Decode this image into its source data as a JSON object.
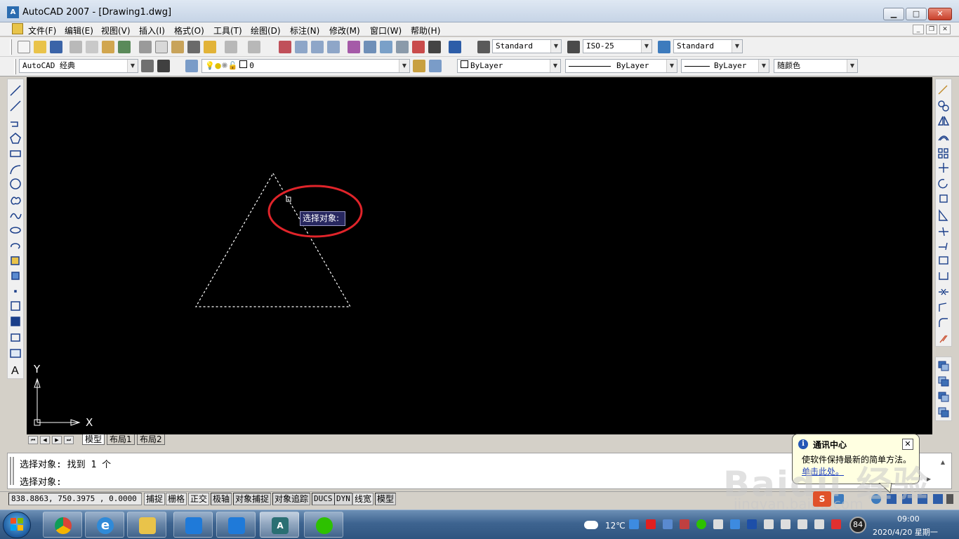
{
  "window": {
    "title": "AutoCAD 2007 - [Drawing1.dwg]",
    "min": "▁",
    "max": "□",
    "close": "✕"
  },
  "menu": [
    "文件(F)",
    "编辑(E)",
    "视图(V)",
    "插入(I)",
    "格式(O)",
    "工具(T)",
    "绘图(D)",
    "标注(N)",
    "修改(M)",
    "窗口(W)",
    "帮助(H)"
  ],
  "toolbar": {
    "text_style": "Standard",
    "dim_style": "ISO-25",
    "table_style": "Standard",
    "workspace": "AutoCAD 经典",
    "layer": "0",
    "color": "ByLayer",
    "linetype": "ByLayer",
    "lineweight": "ByLayer",
    "plotstyle": "随颜色"
  },
  "canvas": {
    "tooltip": "选择对象:",
    "axis_y": "Y",
    "axis_x": "X"
  },
  "layout_tabs": [
    "模型",
    "布局1",
    "布局2"
  ],
  "command": {
    "line1": "选择对象: 找到 1 个",
    "line2": "选择对象:"
  },
  "status": {
    "coords": "838.8863,  750.3975 , 0.0000",
    "toggles": [
      "捕捉",
      "栅格",
      "正交",
      "极轴",
      "对象捕捉",
      "对象追踪",
      "DUCS",
      "DYN",
      "线宽",
      "模型"
    ]
  },
  "balloon": {
    "title": "通讯中心",
    "message": "使软件保持最新的简单方法。",
    "link": "单击此处。"
  },
  "taskbar": {
    "weather": "12℃",
    "time": "09:00",
    "date": "2020/4/20 星期一",
    "badge": "84"
  },
  "watermark": {
    "logo": "Baidu 经验",
    "url": "jingyan.baidu.com"
  },
  "colors": {
    "canvas": "#000000",
    "highlight": "#e0242a",
    "tooltip_bg": "#27275f"
  }
}
